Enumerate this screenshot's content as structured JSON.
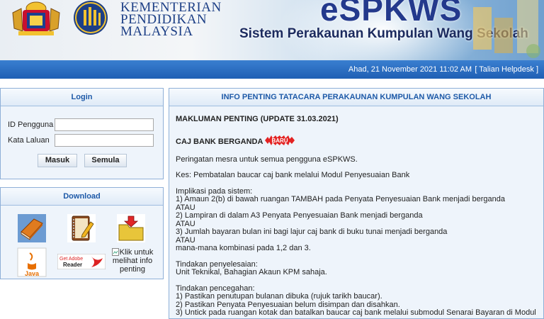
{
  "header": {
    "ministry_lines": [
      "KEMENTERIAN",
      "PENDIDIKAN",
      "MALAYSIA"
    ],
    "app_title": "eSPKWS",
    "app_subtitle": "Sistem Perakaunan Kumpulan Wang Sekolah"
  },
  "topbar": {
    "datetime": "Ahad, 21 November 2021 11:02 AM",
    "helpdesk_link": "[ Talian Helpdesk ]"
  },
  "login": {
    "title": "Login",
    "user_label": "ID Pengguna",
    "user_value": "",
    "password_label": "Kata Laluan",
    "password_value": "",
    "submit_label": "Masuk",
    "reset_label": "Semula"
  },
  "download": {
    "title": "Download",
    "icons": [
      "book-icon",
      "notebook-pencil-icon",
      "folder-download-icon",
      "java-icon",
      "adobe-reader-icon"
    ],
    "adobe_text_1": "Get Adobe",
    "adobe_text_2": "Reader",
    "java_text": "Java",
    "broken_link_text": "Klik untuk melihat info penting"
  },
  "info": {
    "title": "INFO PENTING TATACARA PERAKAUNAN KUMPULAN WANG SEKOLAH",
    "headline": "MAKLUMAN PENTING (UPDATE 31.03.2021)",
    "subheadline": "CAJ BANK BERGANDA",
    "badge": "BARU",
    "paragraphs": [
      [
        "Peringatan mesra untuk semua pengguna eSPKWS."
      ],
      [
        "Kes: Pembatalan baucar caj bank melalui Modul Penyesuaian Bank"
      ],
      [
        "Implikasi pada sistem:",
        "1) Amaun 2(b) di bawah ruangan TAMBAH pada Penyata Penyesuaian Bank menjadi berganda",
        "ATAU",
        "2) Lampiran di dalam A3 Penyata Penyesuaian Bank menjadi berganda",
        "ATAU",
        "3) Jumlah bayaran bulan ini bagi lajur caj bank di buku tunai menjadi berganda",
        "ATAU",
        "mana-mana kombinasi pada 1,2 dan 3."
      ],
      [
        "Tindakan penyelesaian:",
        "Unit Teknikal, Bahagian Akaun KPM sahaja."
      ],
      [
        "Tindakan pencegahan:",
        "1) Pastikan penutupan bulanan dibuka (rujuk tarikh baucar).",
        "2) Pastikan Penyata Penyesuaian belum disimpan dan disahkan.",
        "3) Untick pada ruangan kotak dan batalkan baucar caj bank melalui submodul Senarai Bayaran di Modul"
      ]
    ]
  },
  "colors": {
    "topbar": "#1f5fb4",
    "panel_title": "#1e5aa8",
    "panel_bg": "#eef4fb",
    "badge": "#e32222"
  }
}
